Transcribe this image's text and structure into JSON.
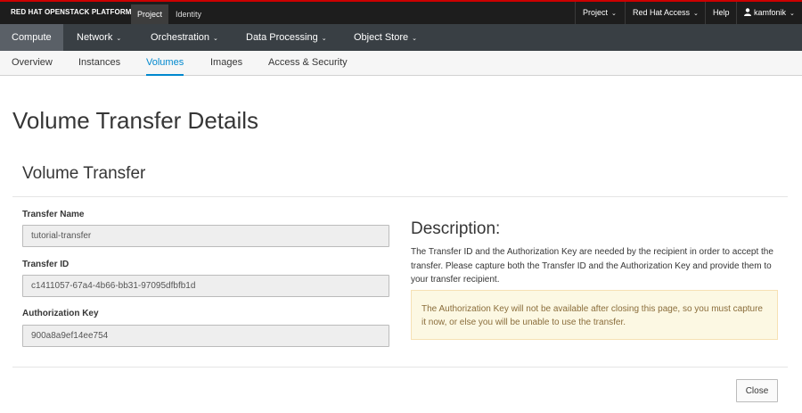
{
  "topbar": {
    "brand": "RED HAT OPENSTACK PLATFORM",
    "tabs": [
      "Project",
      "Identity"
    ],
    "utility": {
      "project": "Project",
      "red_hat_access": "Red Hat Access",
      "help": "Help",
      "user": "kamfonik"
    }
  },
  "main_nav": [
    "Compute",
    "Network",
    "Orchestration",
    "Data Processing",
    "Object Store"
  ],
  "sub_nav": [
    "Overview",
    "Instances",
    "Volumes",
    "Images",
    "Access & Security"
  ],
  "page_title": "Volume Transfer Details",
  "modal": {
    "title": "Volume Transfer",
    "fields": {
      "transfer_name": {
        "label": "Transfer Name",
        "value": "tutorial-transfer"
      },
      "transfer_id": {
        "label": "Transfer ID",
        "value": "c1411057-67a4-4b66-bb31-97095dfbfb1d"
      },
      "auth_key": {
        "label": "Authorization Key",
        "value": "900a8a9ef14ee754"
      }
    },
    "description_title": "Description:",
    "description_text": "The Transfer ID and the Authorization Key are needed by the recipient in order to accept the transfer. Please capture both the Transfer ID and the Authorization Key and provide them to your transfer recipient.",
    "warning_text": "The Authorization Key will not be available after closing this page, so you must capture it now, or else you will be unable to use the transfer.",
    "close_label": "Close"
  },
  "colors": {
    "accent": "#0088ce",
    "topbar_stripe": "#cc0000",
    "warning_bg": "#fcf8e3",
    "warning_text": "#8a6d3b"
  }
}
